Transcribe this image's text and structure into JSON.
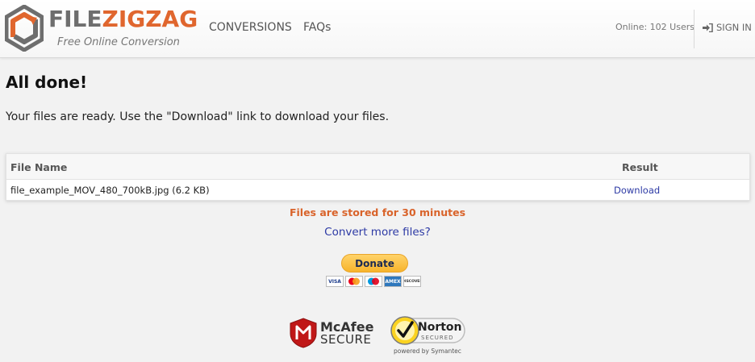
{
  "header": {
    "logo_file": "FILE",
    "logo_zigzag": "ZIGZAG",
    "tagline": "Free Online Conversion",
    "nav": [
      "CONVERSIONS",
      "FAQs"
    ],
    "online_users": "Online: 102 Users",
    "sign_in": "SIGN IN"
  },
  "main": {
    "title": "All done!",
    "subtitle": "Your files are ready. Use the \"Download\" link to download your files.",
    "table": {
      "headers": [
        "File Name",
        "Result"
      ],
      "rows": [
        {
          "file": "file_example_MOV_480_700kB.jpg (6.2 KB)",
          "action": "Download"
        }
      ]
    },
    "notice": "Files are stored for 30 minutes",
    "convert_more": "Convert more files?",
    "donate": "Donate",
    "payment_cards": [
      "VISA",
      "mastercard",
      "maestro",
      "AMEX",
      "DISCOVER"
    ]
  },
  "badges": {
    "mcafee_name": "McAfee",
    "mcafee_secure": "SECURE",
    "norton_name": "Norton",
    "norton_secured": "SECURED",
    "norton_powered": "powered by Symantec"
  },
  "colors": {
    "accent_orange": "#e0662e",
    "link_blue": "#2d3aa5",
    "notice_orange": "#d9632a",
    "donate_yellow": "#f7b42c"
  }
}
